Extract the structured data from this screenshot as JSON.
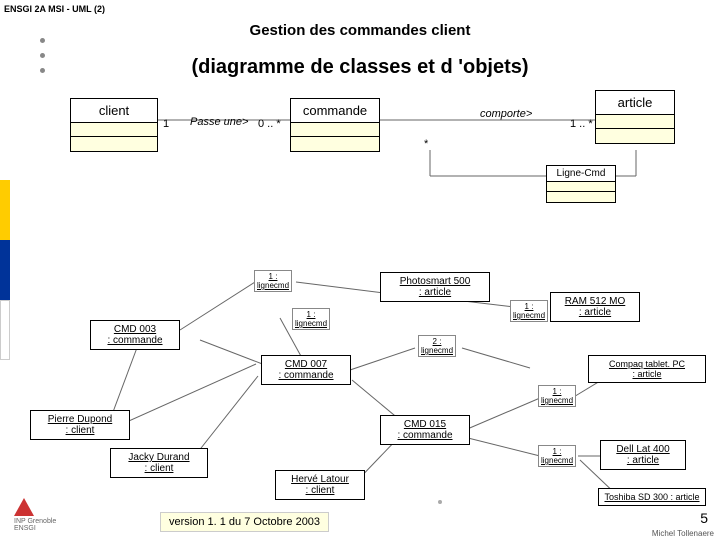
{
  "header": {
    "course": "ENSGI 2A MSI - UML (2)",
    "title": "Gestion des commandes client",
    "subtitle": "(diagramme de classes et d 'objets)"
  },
  "classes": {
    "client": "client",
    "commande": "commande",
    "article": "article",
    "lignecmd": "Ligne-Cmd"
  },
  "assoc": {
    "passe": "Passe une>",
    "comporte": "comporte>"
  },
  "mult": {
    "one": "1",
    "zero_star": "0 .. *",
    "star": "*",
    "one_star": "1 .. *"
  },
  "objects": {
    "cmd003": {
      "name": "CMD 003",
      "type": ": commande"
    },
    "cmd007": {
      "name": "CMD 007",
      "type": ": commande"
    },
    "cmd015": {
      "name": "CMD 015",
      "type": ": commande"
    },
    "pierre": {
      "name": "Pierre Dupond",
      "type": ": client"
    },
    "jacky": {
      "name": "Jacky Durand",
      "type": ": client"
    },
    "herve": {
      "name": "Hervé Latour",
      "type": ": client"
    },
    "photo": {
      "name": "Photosmart 500",
      "type": ": article"
    },
    "ram": {
      "line": "RAM 512 MO",
      "type": ": article"
    },
    "compaq": {
      "line": "Compaq tablet. PC",
      "type": ": article"
    },
    "dell": {
      "line": "Dell Lat 400",
      "type": ": article"
    },
    "toshiba": {
      "line": "Toshiba SD 300 : article"
    }
  },
  "link": {
    "n1": "1 :",
    "n2": "2 :",
    "lc": "lignecmd"
  },
  "footer": {
    "version": "version 1. 1 du 7 Octobre 2003",
    "page": "5",
    "author": "Michel Tollenaere"
  }
}
